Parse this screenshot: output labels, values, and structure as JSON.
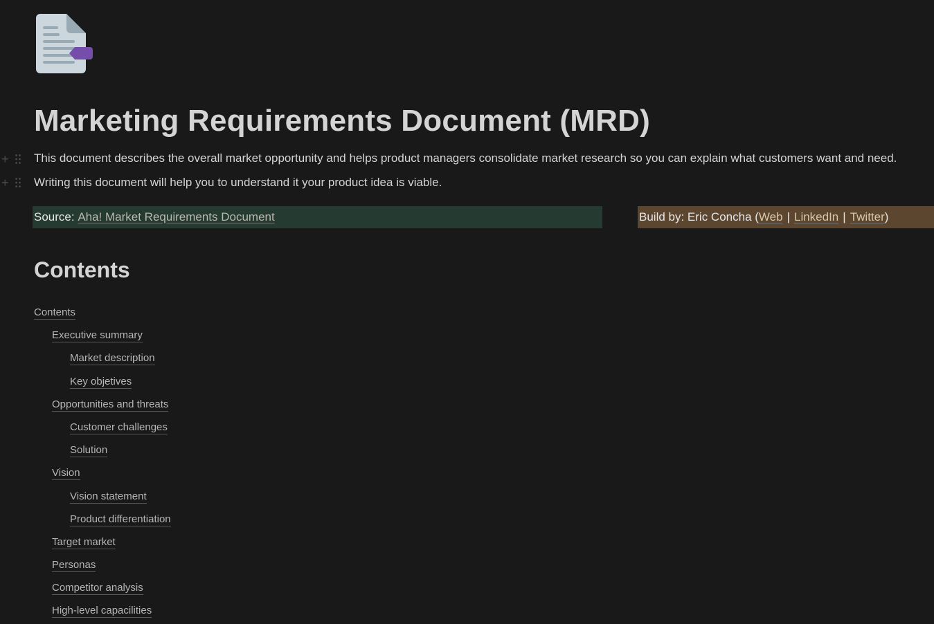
{
  "page": {
    "icon": "document-icon",
    "title": "Marketing Requirements Document (MRD)",
    "paragraphs": [
      "This document describes the overall market opportunity and helps product managers consolidate market research so you can explain what customers want and need.",
      "Writing this document will help you to understand it your product idea is viable."
    ]
  },
  "source_callout": {
    "label": "Source: ",
    "link_text": "Aha! Market Requirements Document",
    "color": "#253b31"
  },
  "build_callout": {
    "label": "Build by: Eric Concha (",
    "links": [
      "Web",
      "LinkedIn",
      "Twitter"
    ],
    "separator": "|",
    "close": ")",
    "color": "#5c4630"
  },
  "contents": {
    "heading": "Contents",
    "items": [
      {
        "label": "Contents",
        "level": 0
      },
      {
        "label": "Executive summary",
        "level": 1
      },
      {
        "label": "Market description",
        "level": 2
      },
      {
        "label": "Key objetives",
        "level": 2
      },
      {
        "label": "Opportunities and threats",
        "level": 1
      },
      {
        "label": "Customer challenges",
        "level": 2
      },
      {
        "label": "Solution",
        "level": 2
      },
      {
        "label": "Vision",
        "level": 1
      },
      {
        "label": "Vision statement",
        "level": 2
      },
      {
        "label": "Product differentiation",
        "level": 2
      },
      {
        "label": "Target market",
        "level": 1
      },
      {
        "label": "Personas",
        "level": 1
      },
      {
        "label": "Competitor analysis",
        "level": 1
      },
      {
        "label": "High-level capacilities",
        "level": 1
      }
    ]
  }
}
